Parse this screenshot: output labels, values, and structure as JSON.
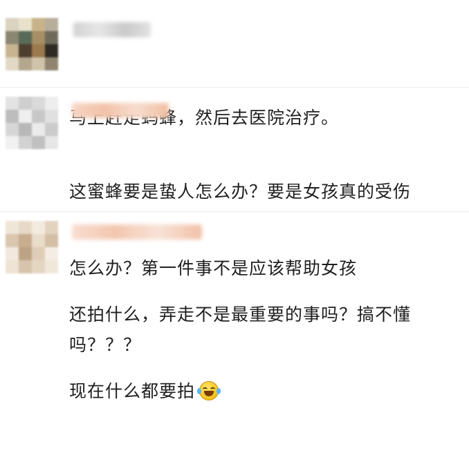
{
  "comments": [
    {
      "text_lines": [
        "马上赶走蚂蜂，然后去医院治疗。"
      ]
    },
    {
      "text_lines": [
        "这蜜蜂要是蛰人怎么办？要是女孩真的受伤",
        "怎么办？第一件事不是应该帮助女孩",
        "吗？？？"
      ]
    },
    {
      "text_lines": [
        "还拍什么，弄走不是最重要的事吗？搞不懂",
        "现在什么都要拍"
      ],
      "emoji": "crying-laughing-emoji"
    }
  ],
  "colors": {
    "text": "#1f1f1f",
    "divider": "#ececec",
    "name_blur_gray": "#d8d8d8",
    "name_blur_peach": "#f4c9b1"
  }
}
